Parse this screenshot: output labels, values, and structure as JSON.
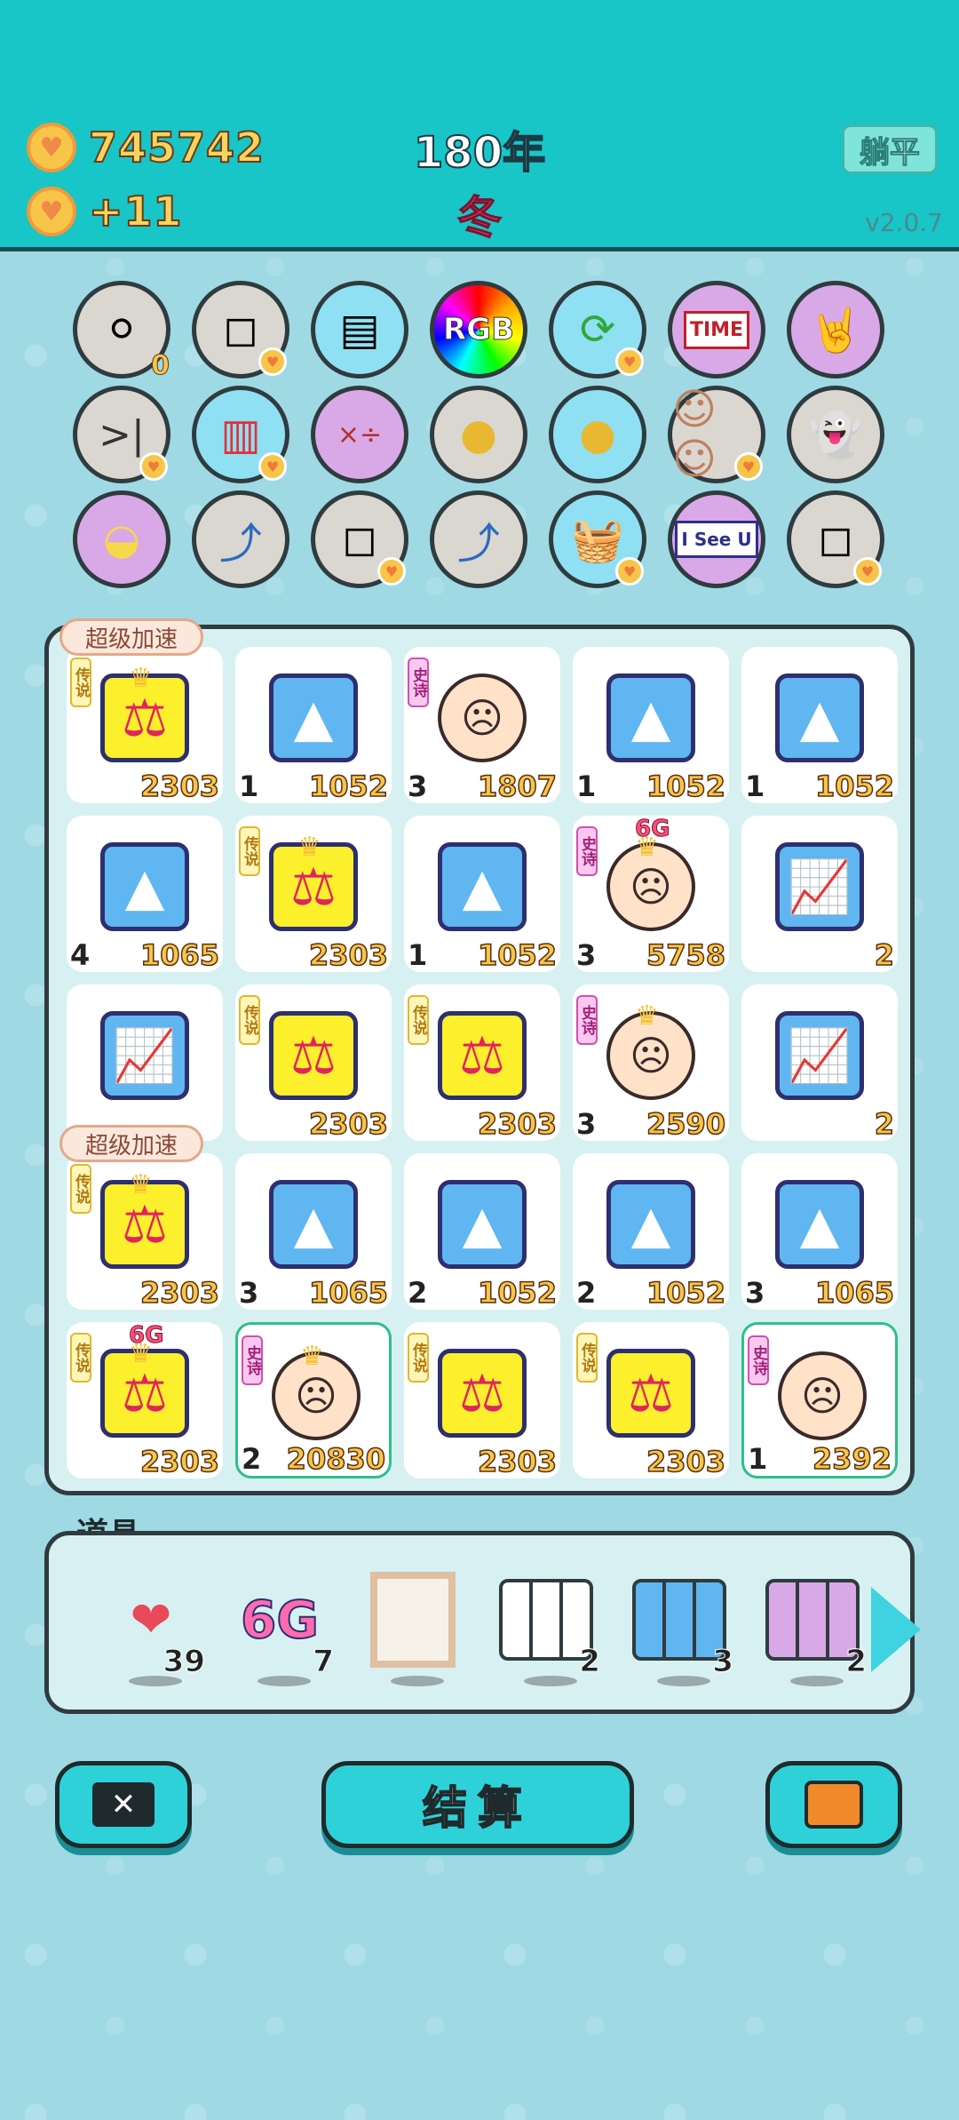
{
  "header": {
    "coins": "745742",
    "income": "+11",
    "year": "180年",
    "season": "冬",
    "flat_button": "躺平",
    "version": "v2.0.7"
  },
  "circle_icons": [
    {
      "icon": "egg-tray-icon",
      "badge": "0"
    },
    {
      "icon": "tiles-icon"
    },
    {
      "icon": "skirt-icon"
    },
    {
      "icon": "rgb-icon",
      "text": "RGB"
    },
    {
      "icon": "recycle-icon"
    },
    {
      "icon": "time-magazine-icon",
      "text": "TIME"
    },
    {
      "icon": "rock-hand-icon"
    },
    {
      "icon": "skip-icon"
    },
    {
      "icon": "fries-icon"
    },
    {
      "icon": "math-head-icon"
    },
    {
      "icon": "chick-egg-icon"
    },
    {
      "icon": "chick-egg-icon"
    },
    {
      "icon": "couple-icon"
    },
    {
      "icon": "ghost-icon"
    },
    {
      "icon": "hatched-egg-icon"
    },
    {
      "icon": "curve-arrow-icon"
    },
    {
      "icon": "tiles-icon"
    },
    {
      "icon": "curve-arrow-icon"
    },
    {
      "icon": "basket-icon"
    },
    {
      "icon": "i-see-u-icon",
      "text": "I See U"
    },
    {
      "icon": "tiles-icon"
    }
  ],
  "boost_label": "超级加速",
  "tag_legend": "传说",
  "tag_epic": "史诗",
  "sixg": "6G",
  "board": [
    {
      "type": "scale",
      "tag": "legend",
      "crown": true,
      "lvl": "",
      "val": "2303"
    },
    {
      "type": "gold",
      "lvl": "1",
      "val": "1052"
    },
    {
      "type": "face",
      "tag": "epic",
      "lvl": "3",
      "val": "1807"
    },
    {
      "type": "gold",
      "lvl": "1",
      "val": "1052"
    },
    {
      "type": "gold",
      "lvl": "1",
      "val": "1052"
    },
    {
      "type": "gold",
      "lvl": "4",
      "val": "1065"
    },
    {
      "type": "scale",
      "tag": "legend",
      "crown": true,
      "lvl": "",
      "val": "2303"
    },
    {
      "type": "gold",
      "lvl": "1",
      "val": "1052"
    },
    {
      "type": "face",
      "tag": "epic",
      "crown": true,
      "sixg": true,
      "lvl": "3",
      "val": "5758"
    },
    {
      "type": "chart",
      "lvl": "",
      "val": "2"
    },
    {
      "type": "chart",
      "lvl": "",
      "val": ""
    },
    {
      "type": "scale",
      "tag": "legend",
      "lvl": "",
      "val": "2303"
    },
    {
      "type": "scale",
      "tag": "legend",
      "lvl": "",
      "val": "2303"
    },
    {
      "type": "face",
      "tag": "epic",
      "crown": true,
      "lvl": "3",
      "val": "2590"
    },
    {
      "type": "chart",
      "lvl": "",
      "val": "2"
    },
    {
      "type": "scale",
      "tag": "legend",
      "crown": true,
      "lvl": "",
      "val": "2303"
    },
    {
      "type": "gold",
      "lvl": "3",
      "val": "1065"
    },
    {
      "type": "gold",
      "lvl": "2",
      "val": "1052"
    },
    {
      "type": "gold",
      "lvl": "2",
      "val": "1052"
    },
    {
      "type": "gold",
      "lvl": "3",
      "val": "1065"
    },
    {
      "type": "scale",
      "tag": "legend",
      "crown": true,
      "sixg": true,
      "lvl": "",
      "val": "2303"
    },
    {
      "type": "face",
      "tag": "epic",
      "crown": true,
      "sel": true,
      "lvl": "2",
      "val": "20830"
    },
    {
      "type": "scale",
      "tag": "legend",
      "lvl": "",
      "val": "2303"
    },
    {
      "type": "scale",
      "tag": "legend",
      "lvl": "",
      "val": "2303"
    },
    {
      "type": "face",
      "tag": "epic",
      "sel": true,
      "lvl": "1",
      "val": "2392"
    }
  ],
  "items_title": "道具",
  "items": [
    {
      "icon": "liver-icon",
      "count": "39"
    },
    {
      "icon": "6g-icon",
      "text": "6G",
      "count": "7"
    },
    {
      "icon": "frame-icon",
      "count": ""
    },
    {
      "icon": "empty-cards-icon",
      "count": "2"
    },
    {
      "icon": "rare-cards-icon",
      "count": "3"
    },
    {
      "icon": "epic-cards-icon",
      "count": "2"
    }
  ],
  "buttons": {
    "settle": "结算"
  }
}
